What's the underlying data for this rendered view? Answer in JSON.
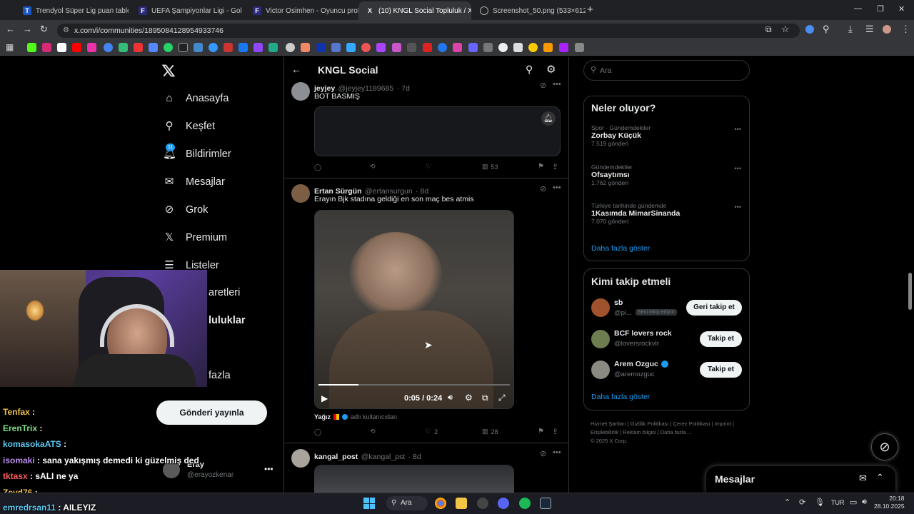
{
  "browser": {
    "tabs": [
      {
        "title": "Trendyol Süper Lig puan tablosu"
      },
      {
        "title": "UEFA Şampiyonlar Ligi - Gol Kr"
      },
      {
        "title": "Victor Osimhen - Oyuncu profili"
      },
      {
        "title": "(10) KNGL Social Topluluk / X"
      },
      {
        "title": "Screenshot_50.png (533×612)"
      }
    ],
    "new_tab": "+",
    "url": "x.com/i/communities/1895084128954933746",
    "window_controls": {
      "minimize": "—",
      "maximize": "❐",
      "close": "✕"
    }
  },
  "sidebar": {
    "items": [
      {
        "label": "Anasayfa",
        "icon": "home-icon"
      },
      {
        "label": "Keşfet",
        "icon": "search-icon"
      },
      {
        "label": "Bildirimler",
        "icon": "bell-icon",
        "badge": "11"
      },
      {
        "label": "Mesajlar",
        "icon": "mail-icon"
      },
      {
        "label": "Grok",
        "icon": "grok-icon"
      },
      {
        "label": "Premium",
        "icon": "x-logo-icon"
      },
      {
        "label": "Listeler",
        "icon": "list-icon"
      },
      {
        "label": "aretleri",
        "icon": "bookmark-icon"
      },
      {
        "label": "luluklar",
        "icon": "communities-icon"
      },
      {
        "label": "fazla",
        "icon": "more-icon"
      }
    ],
    "post_button": "Gönderi yayınla",
    "profile": {
      "name": "Eray",
      "handle": "@erayozkenar"
    }
  },
  "header": {
    "title": "KNGL Social"
  },
  "tweets": [
    {
      "name": "jeyjey",
      "handle": "@jeyjey1189685",
      "time": "· 7d",
      "text": "BOT BASMIŞ",
      "reply": "",
      "retweet": "",
      "like": "",
      "views": "53"
    },
    {
      "name": "Ertan Sürgün",
      "handle": "@ertansurgun",
      "time": "· 8d",
      "text": "Erayın Bjk stadına geldiği en son maç bes atmis",
      "video_time": "0:05 / 0:24",
      "video_progress": 0.21,
      "tagged_user": "Yağız",
      "tagged_suffix": "adlı kullanıcıdan",
      "reply": "",
      "retweet": "",
      "like": "2",
      "views": "28"
    },
    {
      "name": "kangal_post",
      "handle": "@kangal_pst",
      "time": "· 8d"
    }
  ],
  "search": {
    "placeholder": "Ara"
  },
  "trends": {
    "title": "Neler oluyor?",
    "items": [
      {
        "category": "Spor · Gündemdekiler",
        "name": "Zorbay Küçük",
        "count": "7.519 gönderi"
      },
      {
        "category": "Gündemdekiler",
        "name": "Ofsaytımsı",
        "count": "1.762 gönderi"
      },
      {
        "category": "Türkiye tarihinde gündemde",
        "name": "1Kasımda MimarSinanda",
        "count": "7.070 gönderi"
      }
    ],
    "more": "Daha fazla göster"
  },
  "who_to_follow": {
    "title": "Kimi takip etmeli",
    "items": [
      {
        "name": "sb",
        "handle": "@pi...",
        "badge": "Seni takip ediyor",
        "button": "Geri takip et"
      },
      {
        "name": "BCF lovers rock",
        "handle": "@loversrockvlr",
        "button": "Takip et"
      },
      {
        "name": "Arem Ozguc",
        "handle": "@aremozguc",
        "verified": true,
        "button": "Takip et"
      }
    ],
    "more": "Daha fazla göster"
  },
  "footer": {
    "links": [
      "Hizmet Şartları",
      "Gizlilik Politikası",
      "Çerez Politikası",
      "Imprint",
      "Erişilebilirlik",
      "Reklam bilgisi",
      "Daha fazla ..."
    ],
    "copyright": "© 2025 X Corp."
  },
  "messages_drawer": {
    "title": "Mesajlar"
  },
  "chat": [
    {
      "user": "Tenfax",
      "msg": "",
      "color": "#f2c14e"
    },
    {
      "user": "ErenTrix",
      "msg": "",
      "color": "#7fe08a"
    },
    {
      "user": "komasokaATS",
      "msg": "",
      "color": "#5ec8f2"
    },
    {
      "user": "isomaki",
      "msg": "sana yakışmış demedi ki güzelmiş ded",
      "color": "#b98cf0"
    },
    {
      "user": "tktasx",
      "msg": "sALI ne ya",
      "color": "#ff5a5a"
    },
    {
      "user": "Zeyd76",
      "msg": "",
      "color": "#f2c14e"
    },
    {
      "user": "emredrsan11",
      "msg": "AILEYIZ",
      "color": "#5ec8f2"
    }
  ],
  "taskbar": {
    "search": "Ara",
    "lang": "TUR",
    "time": "20:18",
    "date": "28.10.2025"
  },
  "colors": {
    "accent": "#1d9bf0",
    "background": "#000000",
    "border": "#2f3336",
    "muted": "#71767b"
  }
}
